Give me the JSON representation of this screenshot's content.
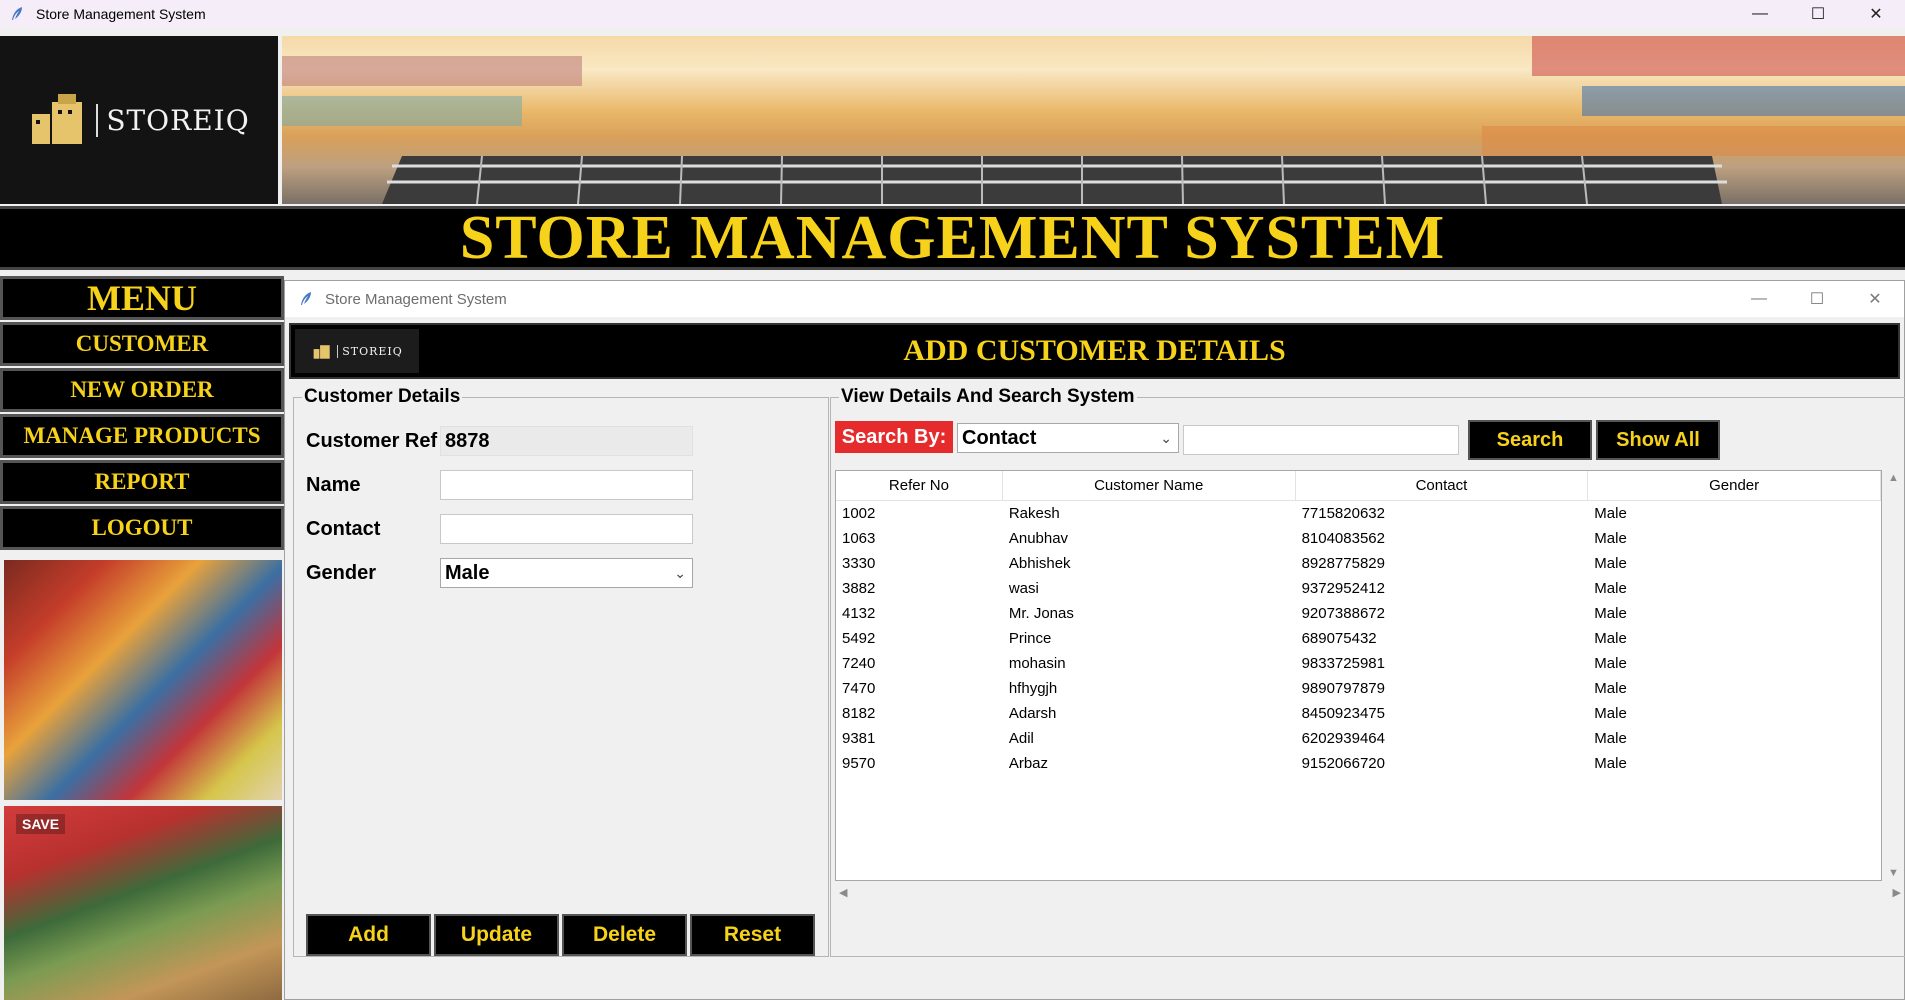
{
  "os_window": {
    "title": "Store Management System"
  },
  "logo": {
    "text": "STOREIQ"
  },
  "main_title": "STORE MANAGEMENT SYSTEM",
  "menu": {
    "heading": "MENU",
    "items": [
      "CUSTOMER",
      "NEW ORDER",
      "MANAGE PRODUCTS",
      "REPORT",
      "LOGOUT"
    ]
  },
  "photos": {
    "second_sign": "SAVE"
  },
  "inner_window": {
    "title": "Store Management System",
    "heading": "ADD CUSTOMER DETAILS",
    "mini_logo_text": "STOREIQ"
  },
  "customer_details": {
    "frame_title": "Customer Details",
    "labels": {
      "ref": "Customer Ref",
      "name": "Name",
      "contact": "Contact",
      "gender": "Gender"
    },
    "values": {
      "ref": "8878",
      "name": "",
      "contact": "",
      "gender": "Male"
    },
    "buttons": [
      "Add",
      "Update",
      "Delete",
      "Reset"
    ]
  },
  "view_details": {
    "frame_title": "View Details And Search System",
    "search_by_label": "Search By:",
    "search_by_selected": "Contact",
    "search_value": "",
    "search_button": "Search",
    "show_all_button": "Show All",
    "columns": [
      "Refer No",
      "Customer Name",
      "Contact",
      "Gender"
    ],
    "rows": [
      [
        "1002",
        "Rakesh",
        "7715820632",
        "Male"
      ],
      [
        "1063",
        "Anubhav",
        "8104083562",
        "Male"
      ],
      [
        "3330",
        "Abhishek",
        "8928775829",
        "Male"
      ],
      [
        "3882",
        "wasi",
        "9372952412",
        "Male"
      ],
      [
        "4132",
        "Mr. Jonas",
        "9207388672",
        "Male"
      ],
      [
        "5492",
        "Prince",
        "689075432",
        "Male"
      ],
      [
        "7240",
        "mohasin",
        "9833725981",
        "Male"
      ],
      [
        "7470",
        "hfhygjh",
        "9890797879",
        "Male"
      ],
      [
        "8182",
        "Adarsh",
        "8450923475",
        "Male"
      ],
      [
        "9381",
        "Adil",
        "6202939464",
        "Male"
      ],
      [
        "9570",
        "Arbaz",
        "9152066720",
        "Male"
      ]
    ]
  },
  "colors": {
    "accent": "#f7d21a",
    "danger": "#e52b2b",
    "dark": "#000000"
  }
}
